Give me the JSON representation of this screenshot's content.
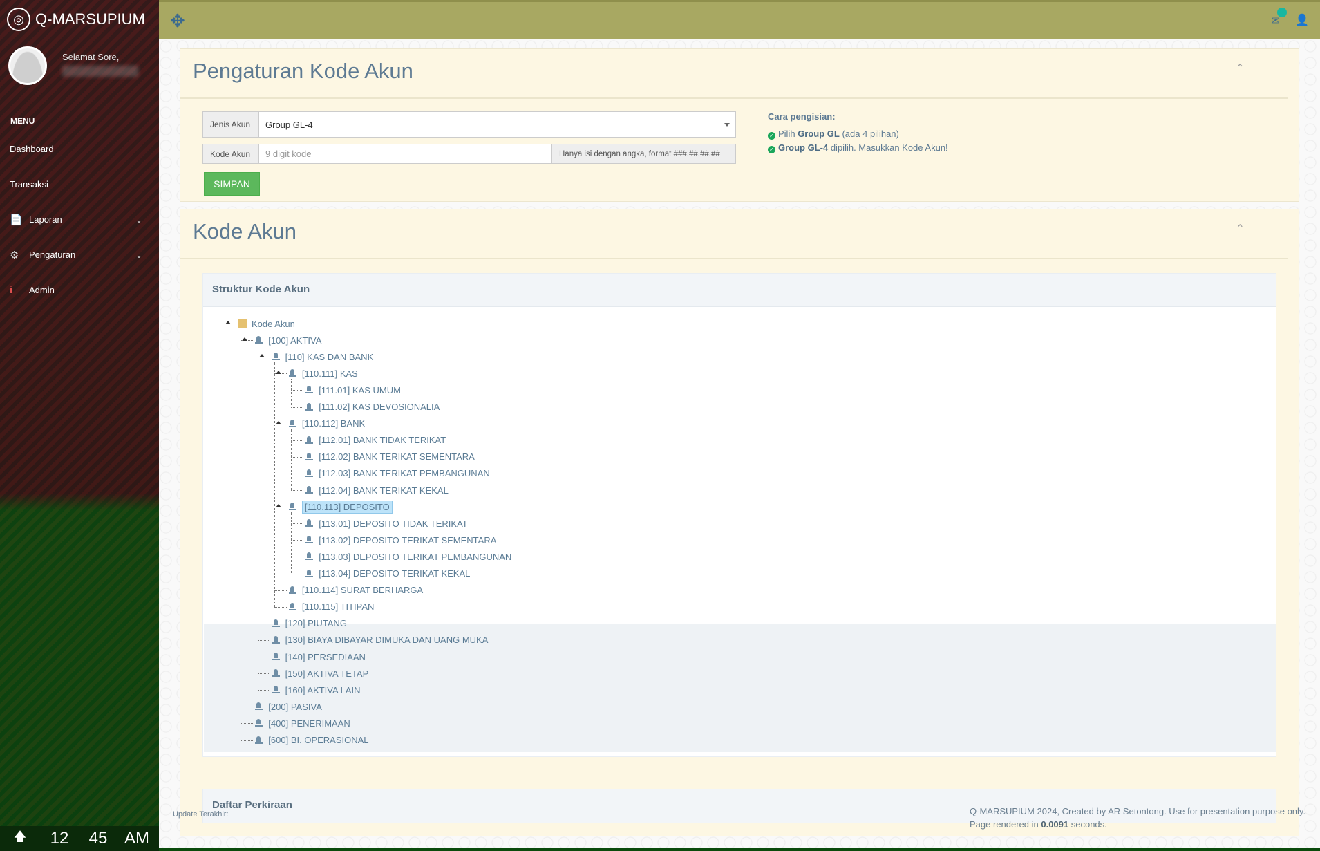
{
  "app": {
    "name": "Q-MARSUPIUM"
  },
  "sidebar": {
    "greeting": "Selamat Sore,",
    "menu_title": "MENU",
    "items": [
      {
        "label": "Dashboard",
        "icon": "none"
      },
      {
        "label": "Transaksi",
        "icon": "none"
      },
      {
        "label": "Laporan",
        "icon": "file-icon",
        "has_submenu": true
      },
      {
        "label": "Pengaturan",
        "icon": "gear-icon",
        "has_submenu": true
      },
      {
        "label": "Admin",
        "icon": "info-icon"
      }
    ],
    "clock": {
      "hour": "12",
      "minute": "45",
      "ampm": "AM"
    }
  },
  "header": {
    "icons": [
      "move-icon",
      "mail-icon",
      "user-icon"
    ]
  },
  "settings_panel": {
    "title": "Pengaturan Kode Akun",
    "jenis_label": "Jenis Akun",
    "jenis_value": "Group GL-4",
    "kode_label": "Kode Akun",
    "kode_placeholder": "9 digit kode",
    "kode_hint": "Hanya isi dengan angka, format ###.##.##.##",
    "save_label": "SIMPAN",
    "help": {
      "title": "Cara pengisian:",
      "line1_pre": "Pilih ",
      "line1_bold": "Group GL",
      "line1_post": " (ada 4 pilihan)",
      "line2_bold": "Group GL-4",
      "line2_post": " dipilih. Masukkan Kode Akun!"
    }
  },
  "kode_panel": {
    "title": "Kode Akun",
    "structure_title": "Struktur Kode Akun",
    "list_title": "Daftar Perkiraan",
    "tree": [
      {
        "label": "Kode Akun",
        "depth": 0,
        "root": true
      },
      {
        "label": "[100] AKTIVA",
        "depth": 1
      },
      {
        "label": "[110] KAS DAN BANK",
        "depth": 2
      },
      {
        "label": "[110.111] KAS",
        "depth": 3
      },
      {
        "label": "[111.01] KAS UMUM",
        "depth": 4
      },
      {
        "label": "[111.02] KAS DEVOSIONALIA",
        "depth": 4
      },
      {
        "label": "[110.112] BANK",
        "depth": 3
      },
      {
        "label": "[112.01] BANK TIDAK TERIKAT",
        "depth": 4
      },
      {
        "label": "[112.02] BANK TERIKAT SEMENTARA",
        "depth": 4
      },
      {
        "label": "[112.03] BANK TERIKAT PEMBANGUNAN",
        "depth": 4
      },
      {
        "label": "[112.04] BANK TERIKAT KEKAL",
        "depth": 4
      },
      {
        "label": "[110.113] DEPOSITO",
        "depth": 3,
        "selected": true
      },
      {
        "label": "[113.01] DEPOSITO TIDAK TERIKAT",
        "depth": 4
      },
      {
        "label": "[113.02] DEPOSITO TERIKAT SEMENTARA",
        "depth": 4
      },
      {
        "label": "[113.03] DEPOSITO TERIKAT PEMBANGUNAN",
        "depth": 4
      },
      {
        "label": "[113.04] DEPOSITO TERIKAT KEKAL",
        "depth": 4
      },
      {
        "label": "[110.114] SURAT BERHARGA",
        "depth": 3
      },
      {
        "label": "[110.115] TITIPAN",
        "depth": 3
      },
      {
        "label": "[120] PIUTANG",
        "depth": 2
      },
      {
        "label": "[130] BIAYA DIBAYAR DIMUKA DAN UANG MUKA",
        "depth": 2
      },
      {
        "label": "[140] PERSEDIAAN",
        "depth": 2
      },
      {
        "label": "[150] AKTIVA TETAP",
        "depth": 2
      },
      {
        "label": "[160] AKTIVA LAIN",
        "depth": 2
      },
      {
        "label": "[200] PASIVA",
        "depth": 1
      },
      {
        "label": "[400] PENERIMAAN",
        "depth": 1
      },
      {
        "label": "[600] BI. OPERASIONAL",
        "depth": 1
      }
    ]
  },
  "footer": {
    "update_label": "Update Terakhir:",
    "credit": "Q-MARSUPIUM 2024, Created by AR Setontong. Use for presentation purpose only.",
    "render_pre": "Page rendered in ",
    "render_time": "0.0091",
    "render_post": " seconds."
  },
  "colors": {
    "header": "#a8a862",
    "panel": "#fdf7e3",
    "save": "#5cb85c",
    "selected": "#bde3f9"
  }
}
